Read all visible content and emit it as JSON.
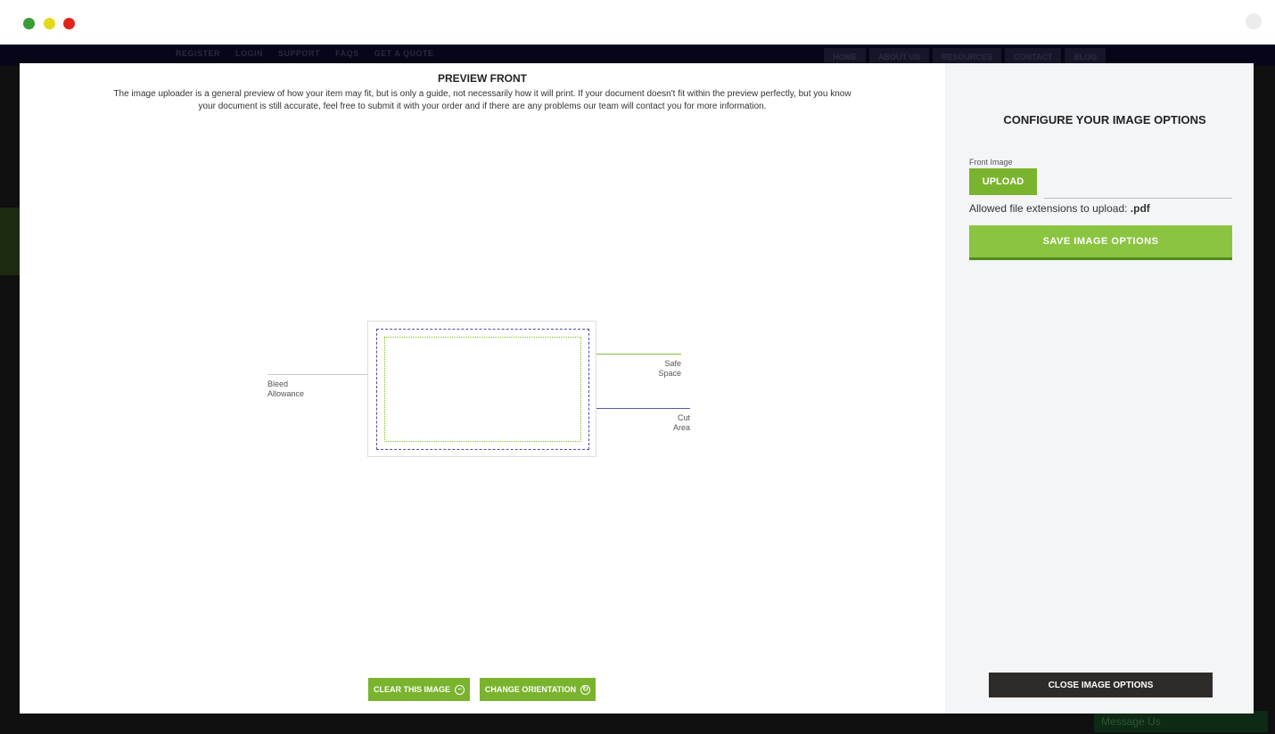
{
  "background_site": {
    "top_links": [
      "REGISTER",
      "LOGIN",
      "SUPPORT",
      "FAQS",
      "GET A QUOTE"
    ],
    "nav": [
      "HOME",
      "ABOUT US",
      "RESOURCES",
      "CONTACT",
      "BLOG"
    ],
    "message_widget": "Message Us"
  },
  "modal": {
    "close_glyph": "✖",
    "preview": {
      "title": "PREVIEW FRONT",
      "description": "The image uploader is a general preview of how your item may fit, but is only a guide, not necessarily how it will print. If your document doesn't fit within the preview perfectly, but you know your document is still accurate, feel free to submit it with your order and if there are any problems our team will contact you for more information.",
      "labels": {
        "bleed_line1": "Bleed",
        "bleed_line2": "Allowance",
        "safe_line1": "Safe",
        "safe_line2": "Space",
        "cut_line1": "Cut",
        "cut_line2": "Area"
      },
      "clear_button": "CLEAR THIS IMAGE",
      "orientation_button": "CHANGE ORIENTATION",
      "clear_icon_glyph": "−",
      "orientation_icon_glyph": "↻"
    },
    "options": {
      "title": "CONFIGURE YOUR IMAGE OPTIONS",
      "front_image_label": "Front Image",
      "upload_button": "UPLOAD",
      "allowed_prefix": "Allowed file extensions to upload:",
      "allowed_ext": ".pdf",
      "save_button": "SAVE IMAGE OPTIONS",
      "close_button": "CLOSE IMAGE OPTIONS"
    }
  },
  "colors": {
    "accent_green": "#7ab32e",
    "dark_button": "#2e2b29",
    "safe_line": "#7fbf1e",
    "cut_line": "#4a4aa8"
  }
}
